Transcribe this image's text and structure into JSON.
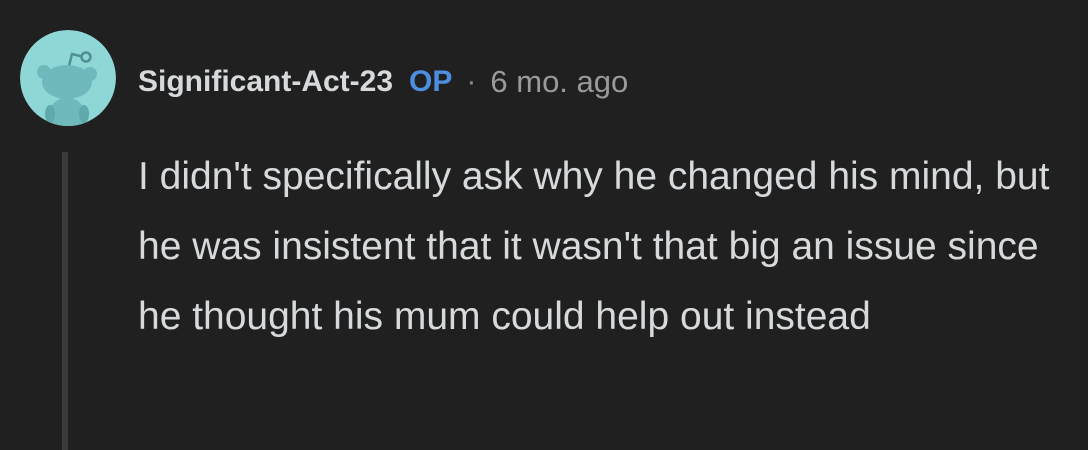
{
  "comment": {
    "avatar_icon": "reddit-snoo-avatar-icon",
    "username": "Significant-Act-23",
    "op_badge": "OP",
    "separator": "·",
    "timestamp": "6 mo. ago",
    "body": "I didn't specifically ask why he changed his mind, but he was insistent that it wasn't that big an issue since he thought his mum could help out instead"
  },
  "colors": {
    "background": "#202020",
    "text": "#d7dadc",
    "op_badge": "#4c8fe0",
    "muted": "#9a9a9a",
    "avatar_bg": "#8fd7d7",
    "thread_line": "#3a3a3a"
  }
}
